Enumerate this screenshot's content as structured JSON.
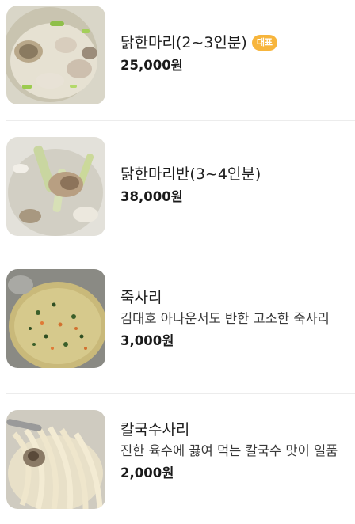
{
  "menu": {
    "items": [
      {
        "name": "닭한마리(2~3인분)",
        "badge": "대표",
        "description": "",
        "price": "25,000원",
        "image": "soup-chicken-photo"
      },
      {
        "name": "닭한마리반(3~4인분)",
        "badge": "",
        "description": "",
        "price": "38,000원",
        "image": "chicken-leek-photo"
      },
      {
        "name": "죽사리",
        "badge": "",
        "description": "김대호 아나운서도 반한 고소한 죽사리",
        "price": "3,000원",
        "image": "porridge-photo"
      },
      {
        "name": "칼국수사리",
        "badge": "",
        "description": "진한 육수에 끓여 먹는 칼국수 맛이 일품",
        "price": "2,000원",
        "image": "noodles-photo"
      }
    ]
  },
  "colors": {
    "badge": "#f7b53c",
    "divider": "#ececec"
  }
}
